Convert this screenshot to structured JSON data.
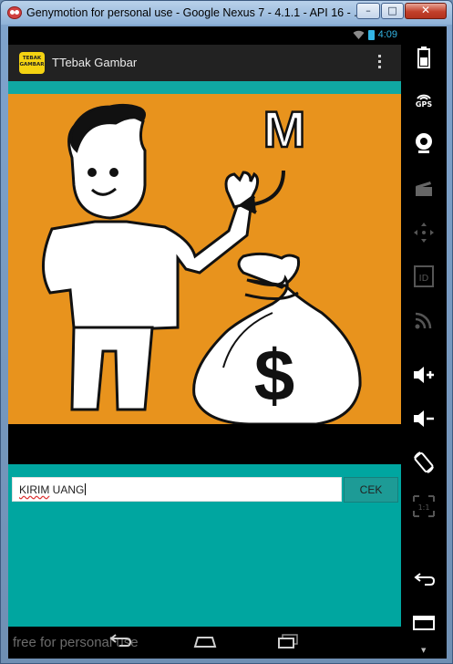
{
  "window": {
    "title": "Genymotion for personal use - Google Nexus 7 - 4.1.1 - API 16 - ...",
    "minimize_glyph": "–",
    "maximize_glyph": "□",
    "close_glyph": "✕"
  },
  "statusbar": {
    "time": "4:09"
  },
  "actionbar": {
    "logo_line1": "TEBAK",
    "logo_line2": "GAMBAR",
    "app_title": "TTebak Gambar"
  },
  "puzzle": {
    "letter": "M",
    "symbol": "$"
  },
  "answer": {
    "word1": "KIRIM",
    "word2": " UANG"
  },
  "check_button": {
    "label": "CEK"
  },
  "watermark": "free for personal use",
  "side_panel": {
    "gps_label": "GPS",
    "id_label": "ID",
    "scale_label": "1:1"
  },
  "colors": {
    "puzzle_bg": "#e8931d",
    "screen_teal": "#00a6a0",
    "status_blue": "#33b5e5"
  }
}
